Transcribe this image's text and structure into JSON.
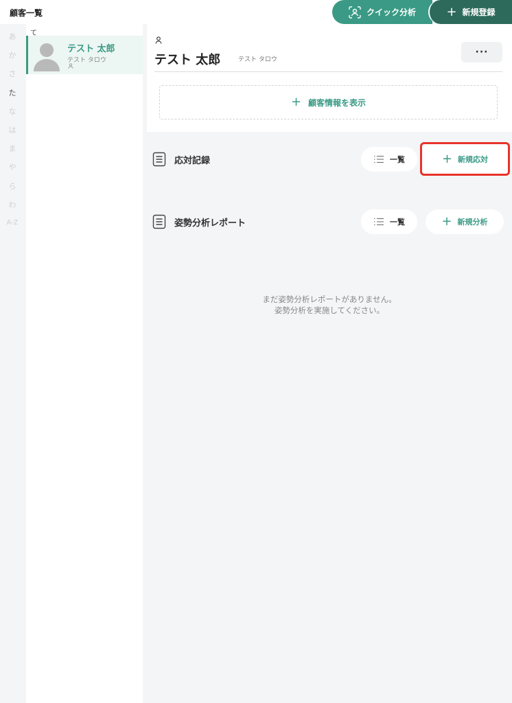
{
  "header": {
    "title": "顧客一覧",
    "quick_analysis": "クイック分析",
    "new_register": "新規登録"
  },
  "kana_index": [
    "あ",
    "か",
    "さ",
    "た",
    "な",
    "は",
    "ま",
    "や",
    "ら",
    "わ",
    "A-Z"
  ],
  "kana_active": "た",
  "customer_list": {
    "group": "て",
    "items": [
      {
        "name": "テスト 太郎",
        "kana": "テスト タロウ"
      }
    ]
  },
  "detail": {
    "name": "テスト 太郎",
    "kana": "テスト タロウ",
    "more": "···",
    "show_info": "顧客情報を表示"
  },
  "sections": {
    "records": {
      "title": "応対記録",
      "list_label": "一覧",
      "new_label": "新規応対"
    },
    "reports": {
      "title": "姿勢分析レポート",
      "list_label": "一覧",
      "new_label": "新規分析"
    }
  },
  "empty_message": {
    "line1": "まだ姿勢分析レポートがありません。",
    "line2": "姿勢分析を実施してください。"
  },
  "colors": {
    "accent": "#3a9a85",
    "accent_dark": "#2e6a5c",
    "highlight": "#e8332b"
  }
}
